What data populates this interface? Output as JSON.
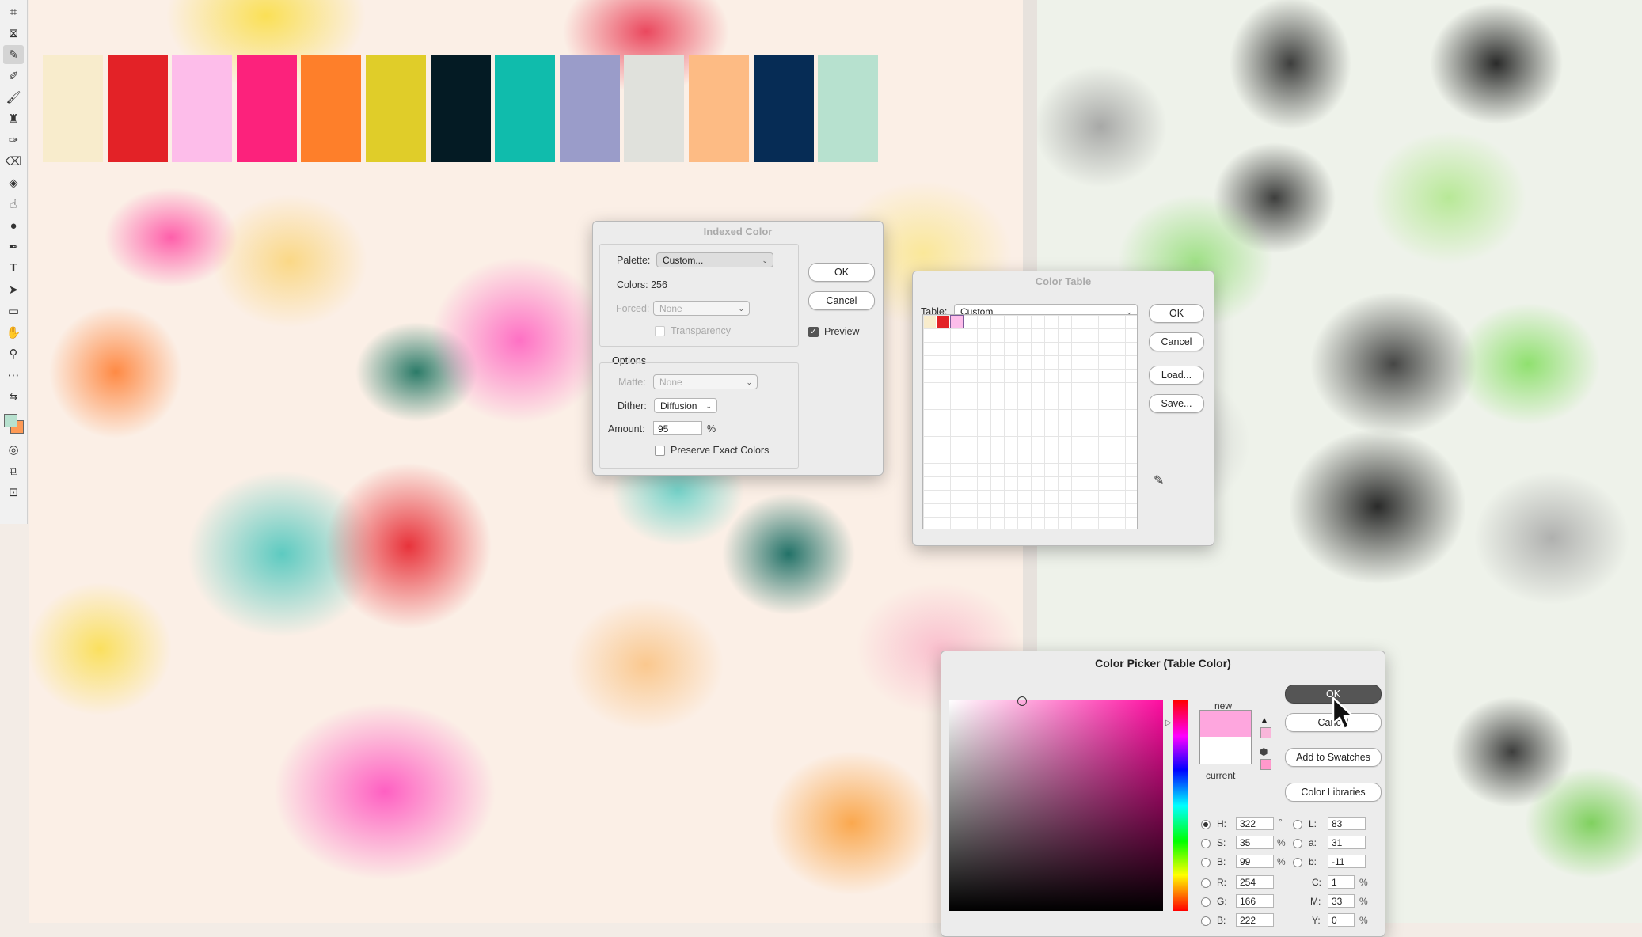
{
  "swatches": [
    "#f8eccc",
    "#e32227",
    "#fdbdea",
    "#fc227c",
    "#fe7f2a",
    "#e0cd29",
    "#041b24",
    "#10bcac",
    "#9a9cc9",
    "#e0e1dc",
    "#fdbb84",
    "#062c55",
    "#b7e1cf"
  ],
  "toolbar": {
    "icons": [
      "crop-icon",
      "frame-icon",
      "eyedropper-icon",
      "healing-brush-icon",
      "brush-icon",
      "stamp-icon",
      "history-brush-icon",
      "eraser-icon",
      "bucket-icon",
      "blur-icon",
      "dodge-icon",
      "pen-icon",
      "type-icon",
      "select-arrow-icon",
      "rectangle-icon",
      "hand-icon",
      "zoom-icon",
      "more-icon"
    ],
    "foreground_color": "#b7e1cf",
    "background_color": "#fe9a55"
  },
  "indexed_color": {
    "title": "Indexed Color",
    "palette_label": "Palette:",
    "palette_value": "Custom...",
    "colors_label": "Colors:",
    "colors_value": "256",
    "forced_label": "Forced:",
    "forced_value": "None",
    "transparency_label": "Transparency",
    "options_title": "Options",
    "matte_label": "Matte:",
    "matte_value": "None",
    "dither_label": "Dither:",
    "dither_value": "Diffusion",
    "amount_label": "Amount:",
    "amount_value": "95",
    "amount_unit": "%",
    "preserve_label": "Preserve Exact Colors",
    "ok": "OK",
    "cancel": "Cancel",
    "preview_label": "Preview",
    "preview_checked": true
  },
  "color_table": {
    "title": "Color Table",
    "table_label": "Table:",
    "table_value": "Custom",
    "ok": "OK",
    "cancel": "Cancel",
    "load": "Load...",
    "save": "Save...",
    "cells": [
      "#f8eccc",
      "#e32227",
      "#fdbdea"
    ]
  },
  "color_picker": {
    "title": "Color Picker (Table Color)",
    "ok": "OK",
    "cancel": "Cancel",
    "add_to_swatches": "Add to Swatches",
    "color_libraries": "Color Libraries",
    "new_label": "new",
    "current_label": "current",
    "new_color": "#fea6de",
    "current_color": "#ffffff",
    "fields": {
      "H": {
        "label": "H:",
        "value": "322",
        "unit": "°"
      },
      "S": {
        "label": "S:",
        "value": "35",
        "unit": "%"
      },
      "B": {
        "label": "B:",
        "value": "99",
        "unit": "%"
      },
      "R": {
        "label": "R:",
        "value": "254",
        "unit": ""
      },
      "G": {
        "label": "G:",
        "value": "166",
        "unit": ""
      },
      "Bl": {
        "label": "B:",
        "value": "222",
        "unit": ""
      },
      "L": {
        "label": "L:",
        "value": "83",
        "unit": ""
      },
      "a": {
        "label": "a:",
        "value": "31",
        "unit": ""
      },
      "b": {
        "label": "b:",
        "value": "-11",
        "unit": ""
      },
      "C": {
        "label": "C:",
        "value": "1",
        "unit": "%"
      },
      "M": {
        "label": "M:",
        "value": "33",
        "unit": "%"
      },
      "Y": {
        "label": "Y:",
        "value": "0",
        "unit": "%"
      }
    }
  }
}
